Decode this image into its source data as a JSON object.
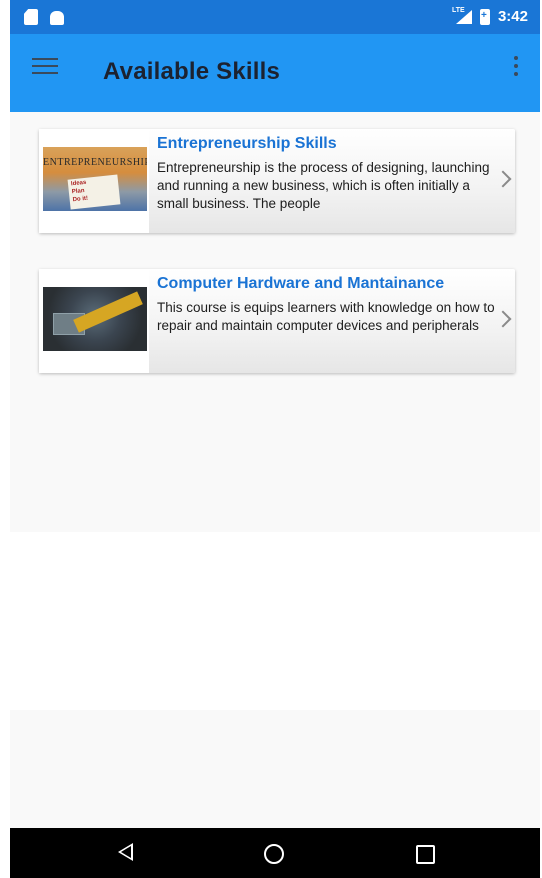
{
  "status_bar": {
    "time": "3:42",
    "icons": [
      "sd-card-icon",
      "android-icon",
      "lte-signal-icon",
      "battery-icon"
    ]
  },
  "app_bar": {
    "title": "Available Skills",
    "color": "#2196f3",
    "left_icon": "menu-icon",
    "right_icon": "overflow-icon"
  },
  "skills": [
    {
      "title": "Entrepreneurship Skills",
      "description": "Entrepreneurship is the process of designing, launching and running a new business, which is often initially a small business. The people",
      "thumbnail": {
        "heading": "ENTREPRENEURSHIP",
        "note": [
          "Ideas",
          "Plan",
          "Do it!"
        ]
      }
    },
    {
      "title": "Computer Hardware and Mantainance",
      "description": "This course is equips learners with knowledge on how to repair and maintain computer devices and peripherals"
    }
  ],
  "colors": {
    "title_blue": "#1a73d4",
    "status_bar": "#1a76d6"
  }
}
